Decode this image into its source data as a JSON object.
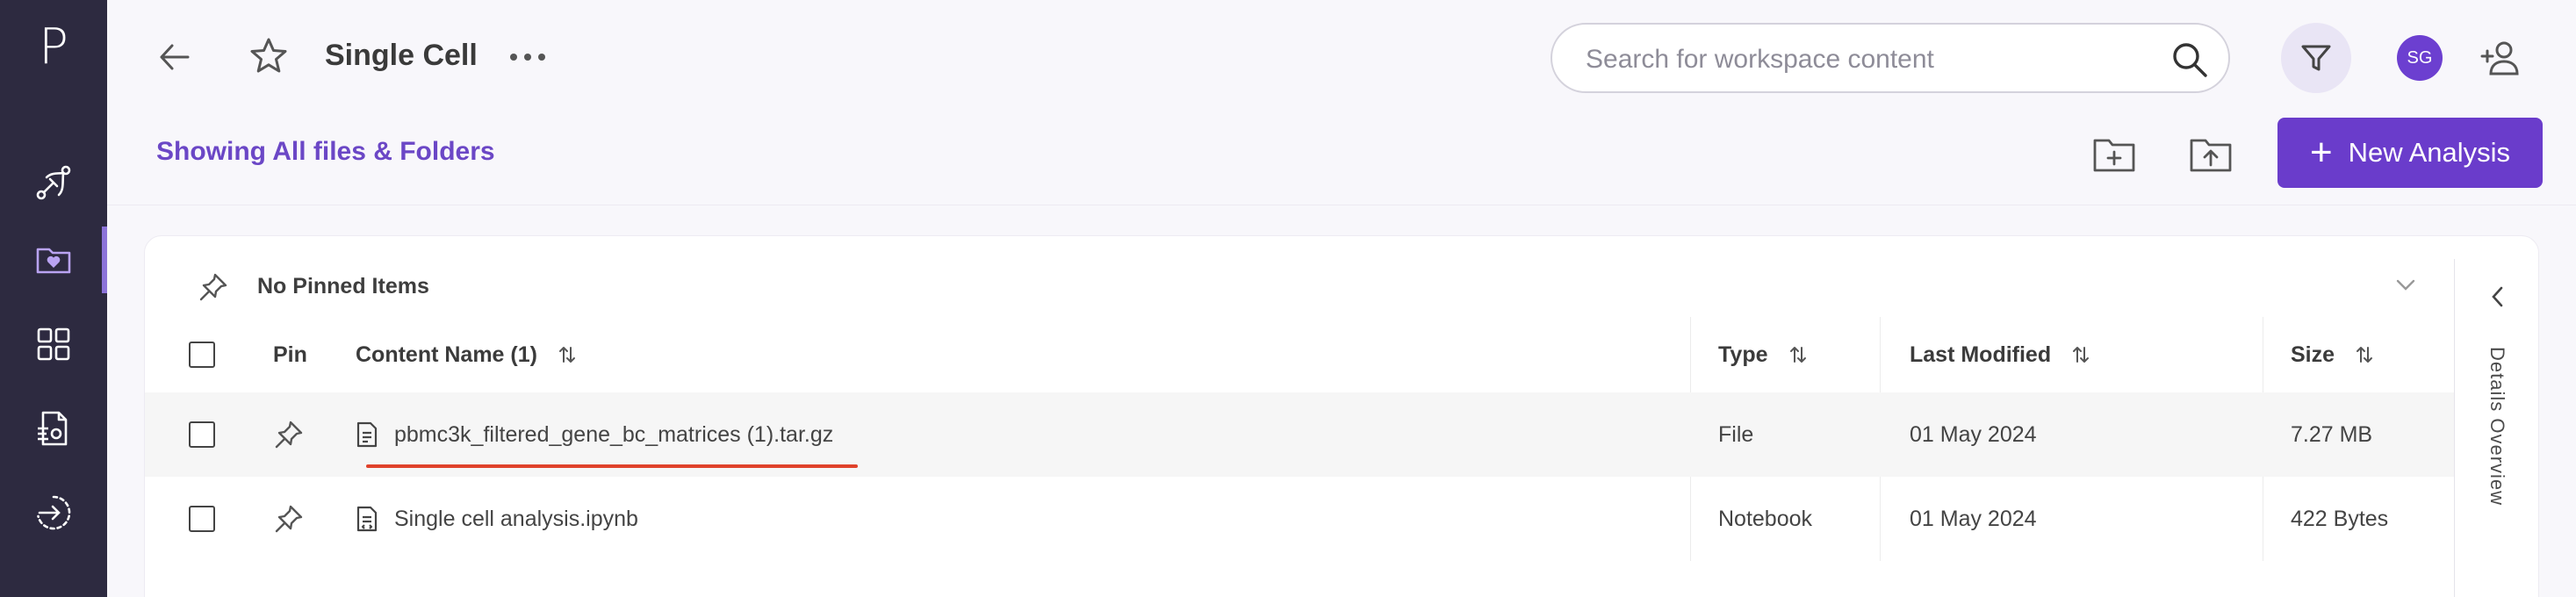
{
  "app": {
    "logo_letter": "P"
  },
  "sidebar": {
    "items": [
      {
        "name": "pipelines",
        "icon": "pipeline-icon",
        "active": false
      },
      {
        "name": "workspaces",
        "icon": "folder-heart-icon",
        "active": true
      },
      {
        "name": "apps",
        "icon": "grid-icon",
        "active": false
      },
      {
        "name": "files",
        "icon": "file-settings-icon",
        "active": false
      },
      {
        "name": "logout",
        "icon": "exit-circle-icon",
        "active": false
      }
    ]
  },
  "header": {
    "title": "Single Cell",
    "search": {
      "placeholder": "Search for workspace content",
      "value": ""
    },
    "avatar_initials": "SG"
  },
  "toolbar": {
    "showing_text": "Showing All files & Folders",
    "new_analysis_label": "New Analysis"
  },
  "pinned": {
    "label": "No Pinned Items"
  },
  "details_panel": {
    "label": "Details Overview"
  },
  "table": {
    "headers": {
      "pin": "Pin",
      "name": "Content Name (1)",
      "type": "Type",
      "modified": "Last Modified",
      "size": "Size"
    },
    "rows": [
      {
        "name": "pbmc3k_filtered_gene_bc_matrices (1).tar.gz",
        "type": "File",
        "modified": "01 May 2024",
        "size": "7.27 MB",
        "icon": "document-icon"
      },
      {
        "name": "Single cell analysis.ipynb",
        "type": "Notebook",
        "modified": "01 May 2024",
        "size": "422 Bytes",
        "icon": "notebook-icon"
      }
    ]
  },
  "colors": {
    "sidebar_bg": "#2d2a40",
    "accent": "#6a3ccb",
    "accent_text": "#6b47c6",
    "annotation_underline": "#e0422b"
  }
}
